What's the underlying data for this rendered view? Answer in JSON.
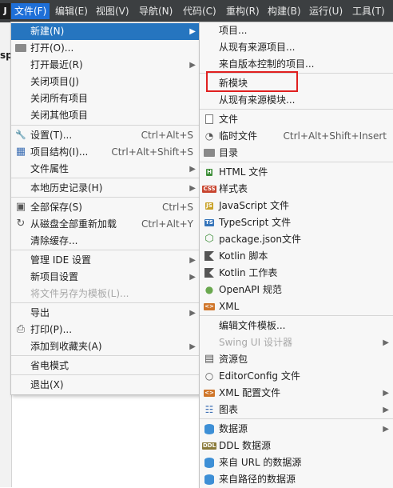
{
  "menubar": {
    "logo": "J",
    "items": [
      "文件(F)",
      "编辑(E)",
      "视图(V)",
      "导航(N)",
      "代码(C)",
      "重构(R)",
      "构建(B)",
      "运行(U)",
      "工具(T)"
    ],
    "active_index": 0
  },
  "background": {
    "fragment": "sp"
  },
  "file_menu": {
    "items": [
      {
        "label": "新建(N)",
        "submenu": true,
        "selected": true
      },
      {
        "label": "打开(O)...",
        "icon": "folder-open-icon"
      },
      {
        "label": "打开最近(R)",
        "submenu": true
      },
      {
        "label": "关闭项目(J)"
      },
      {
        "label": "关闭所有项目"
      },
      {
        "label": "关闭其他项目"
      },
      {
        "label": "设置(T)...",
        "icon": "wrench-icon",
        "shortcut": "Ctrl+Alt+S"
      },
      {
        "label": "项目结构(I)...",
        "icon": "project-structure-icon",
        "shortcut": "Ctrl+Alt+Shift+S"
      },
      {
        "label": "文件属性",
        "submenu": true
      },
      {
        "label": "本地历史记录(H)",
        "submenu": true
      },
      {
        "label": "全部保存(S)",
        "icon": "save-icon",
        "shortcut": "Ctrl+S"
      },
      {
        "label": "从磁盘全部重新加载",
        "icon": "reload-icon",
        "shortcut": "Ctrl+Alt+Y"
      },
      {
        "label": "清除缓存..."
      },
      {
        "label": "管理 IDE 设置",
        "submenu": true
      },
      {
        "label": "新项目设置",
        "submenu": true
      },
      {
        "label": "将文件另存为模板(L)...",
        "disabled": true
      },
      {
        "label": "导出",
        "submenu": true
      },
      {
        "label": "打印(P)...",
        "icon": "print-icon"
      },
      {
        "label": "添加到收藏夹(A)",
        "submenu": true
      },
      {
        "label": "省电模式"
      },
      {
        "label": "退出(X)"
      }
    ]
  },
  "new_menu": {
    "items": [
      {
        "label": "项目..."
      },
      {
        "label": "从现有来源项目..."
      },
      {
        "label": "来自版本控制的项目..."
      },
      {
        "label": "新模块"
      },
      {
        "label": "从现有来源模块..."
      },
      {
        "label": "文件",
        "icon": "file-icon"
      },
      {
        "label": "临时文件",
        "icon": "scratch-file-icon",
        "shortcut": "Ctrl+Alt+Shift+Insert"
      },
      {
        "label": "目录",
        "icon": "folder-icon"
      },
      {
        "label": "HTML 文件",
        "icon": "html-icon",
        "badge": "H",
        "badge_color": "#3f8f3a"
      },
      {
        "label": "样式表",
        "icon": "css-icon",
        "badge": "CSS",
        "badge_color": "#c8452f"
      },
      {
        "label": "JavaScript 文件",
        "icon": "javascript-icon",
        "badge": "JS",
        "badge_color": "#c9a227"
      },
      {
        "label": "TypeScript 文件",
        "icon": "typescript-icon",
        "badge": "TS",
        "badge_color": "#3574b9"
      },
      {
        "label": "package.json文件",
        "icon": "package-json-icon"
      },
      {
        "label": "Kotlin 脚本",
        "icon": "kotlin-script-icon"
      },
      {
        "label": "Kotlin 工作表",
        "icon": "kotlin-worksheet-icon"
      },
      {
        "label": "OpenAPI 规范",
        "icon": "openapi-icon"
      },
      {
        "label": "XML",
        "icon": "xml-icon",
        "badge": "<>",
        "badge_color": "#d0762a"
      },
      {
        "label": "编辑文件模板..."
      },
      {
        "label": "Swing UI 设计器",
        "submenu": true,
        "disabled": true
      },
      {
        "label": "资源包",
        "icon": "resource-bundle-icon"
      },
      {
        "label": "EditorConfig 文件",
        "icon": "editorconfig-icon"
      },
      {
        "label": "XML 配置文件",
        "icon": "xml-config-icon",
        "badge": "<>",
        "badge_color": "#d0762a",
        "submenu": true
      },
      {
        "label": "图表",
        "icon": "diagram-icon",
        "submenu": true
      },
      {
        "label": "数据源",
        "icon": "datasource-icon",
        "submenu": true
      },
      {
        "label": "DDL 数据源",
        "icon": "ddl-icon",
        "badge": "DDL",
        "badge_color": "#8a7a3a"
      },
      {
        "label": "来自 URL 的数据源",
        "icon": "url-datasource-icon"
      },
      {
        "label": "来自路径的数据源",
        "icon": "path-datasource-icon"
      }
    ]
  }
}
